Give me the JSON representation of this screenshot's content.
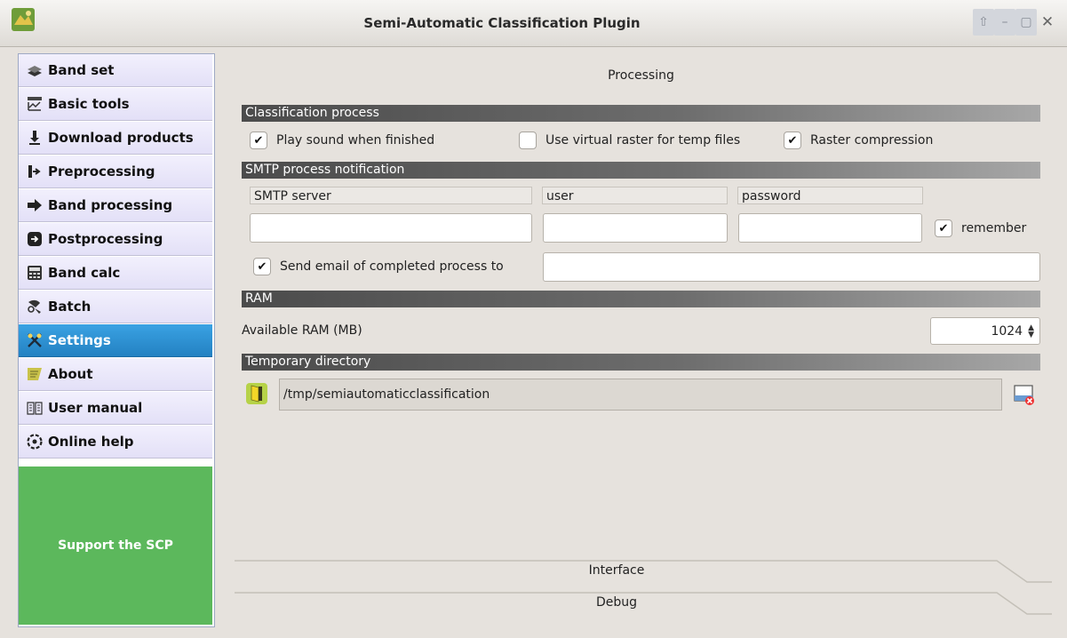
{
  "window": {
    "title": "Semi-Automatic Classification Plugin",
    "controls": [
      "restore-icon",
      "minimize-icon",
      "maximize-icon",
      "close-icon"
    ]
  },
  "sidebar": {
    "items": [
      {
        "label": "Band set",
        "icon": "band-set-icon"
      },
      {
        "label": "Basic tools",
        "icon": "basic-tools-icon"
      },
      {
        "label": "Download products",
        "icon": "download-icon"
      },
      {
        "label": "Preprocessing",
        "icon": "preprocessing-icon"
      },
      {
        "label": "Band processing",
        "icon": "band-processing-icon"
      },
      {
        "label": "Postprocessing",
        "icon": "postprocessing-icon"
      },
      {
        "label": "Band calc",
        "icon": "calculator-icon"
      },
      {
        "label": "Batch",
        "icon": "batch-icon"
      },
      {
        "label": "Settings",
        "icon": "settings-icon",
        "active": true
      },
      {
        "label": "About",
        "icon": "about-icon"
      },
      {
        "label": "User manual",
        "icon": "manual-icon"
      },
      {
        "label": "Online help",
        "icon": "help-icon"
      }
    ],
    "support_label": "Support the SCP",
    "active_color": "#2b8fd4",
    "support_color": "#5cb85c"
  },
  "main": {
    "title": "Processing",
    "classification": {
      "header": "Classification process",
      "play_sound": {
        "label": "Play sound when finished",
        "checked": true
      },
      "virtual_raster": {
        "label": "Use virtual raster for temp files",
        "checked": false
      },
      "compression": {
        "label": "Raster compression",
        "checked": true
      }
    },
    "smtp": {
      "header": "SMTP process notification",
      "server_label": "SMTP server",
      "user_label": "user",
      "password_label": "password",
      "server_value": "",
      "user_value": "",
      "password_value": "",
      "remember": {
        "label": "remember",
        "checked": true
      },
      "send_email": {
        "label": "Send email of completed process to",
        "checked": true
      },
      "email_value": ""
    },
    "ram": {
      "header": "RAM",
      "label": "Available RAM (MB)",
      "value": "1024"
    },
    "temp": {
      "header": "Temporary directory",
      "path": "/tmp/semiautomaticclassification"
    },
    "accordion": [
      "Interface",
      "Debug"
    ]
  }
}
